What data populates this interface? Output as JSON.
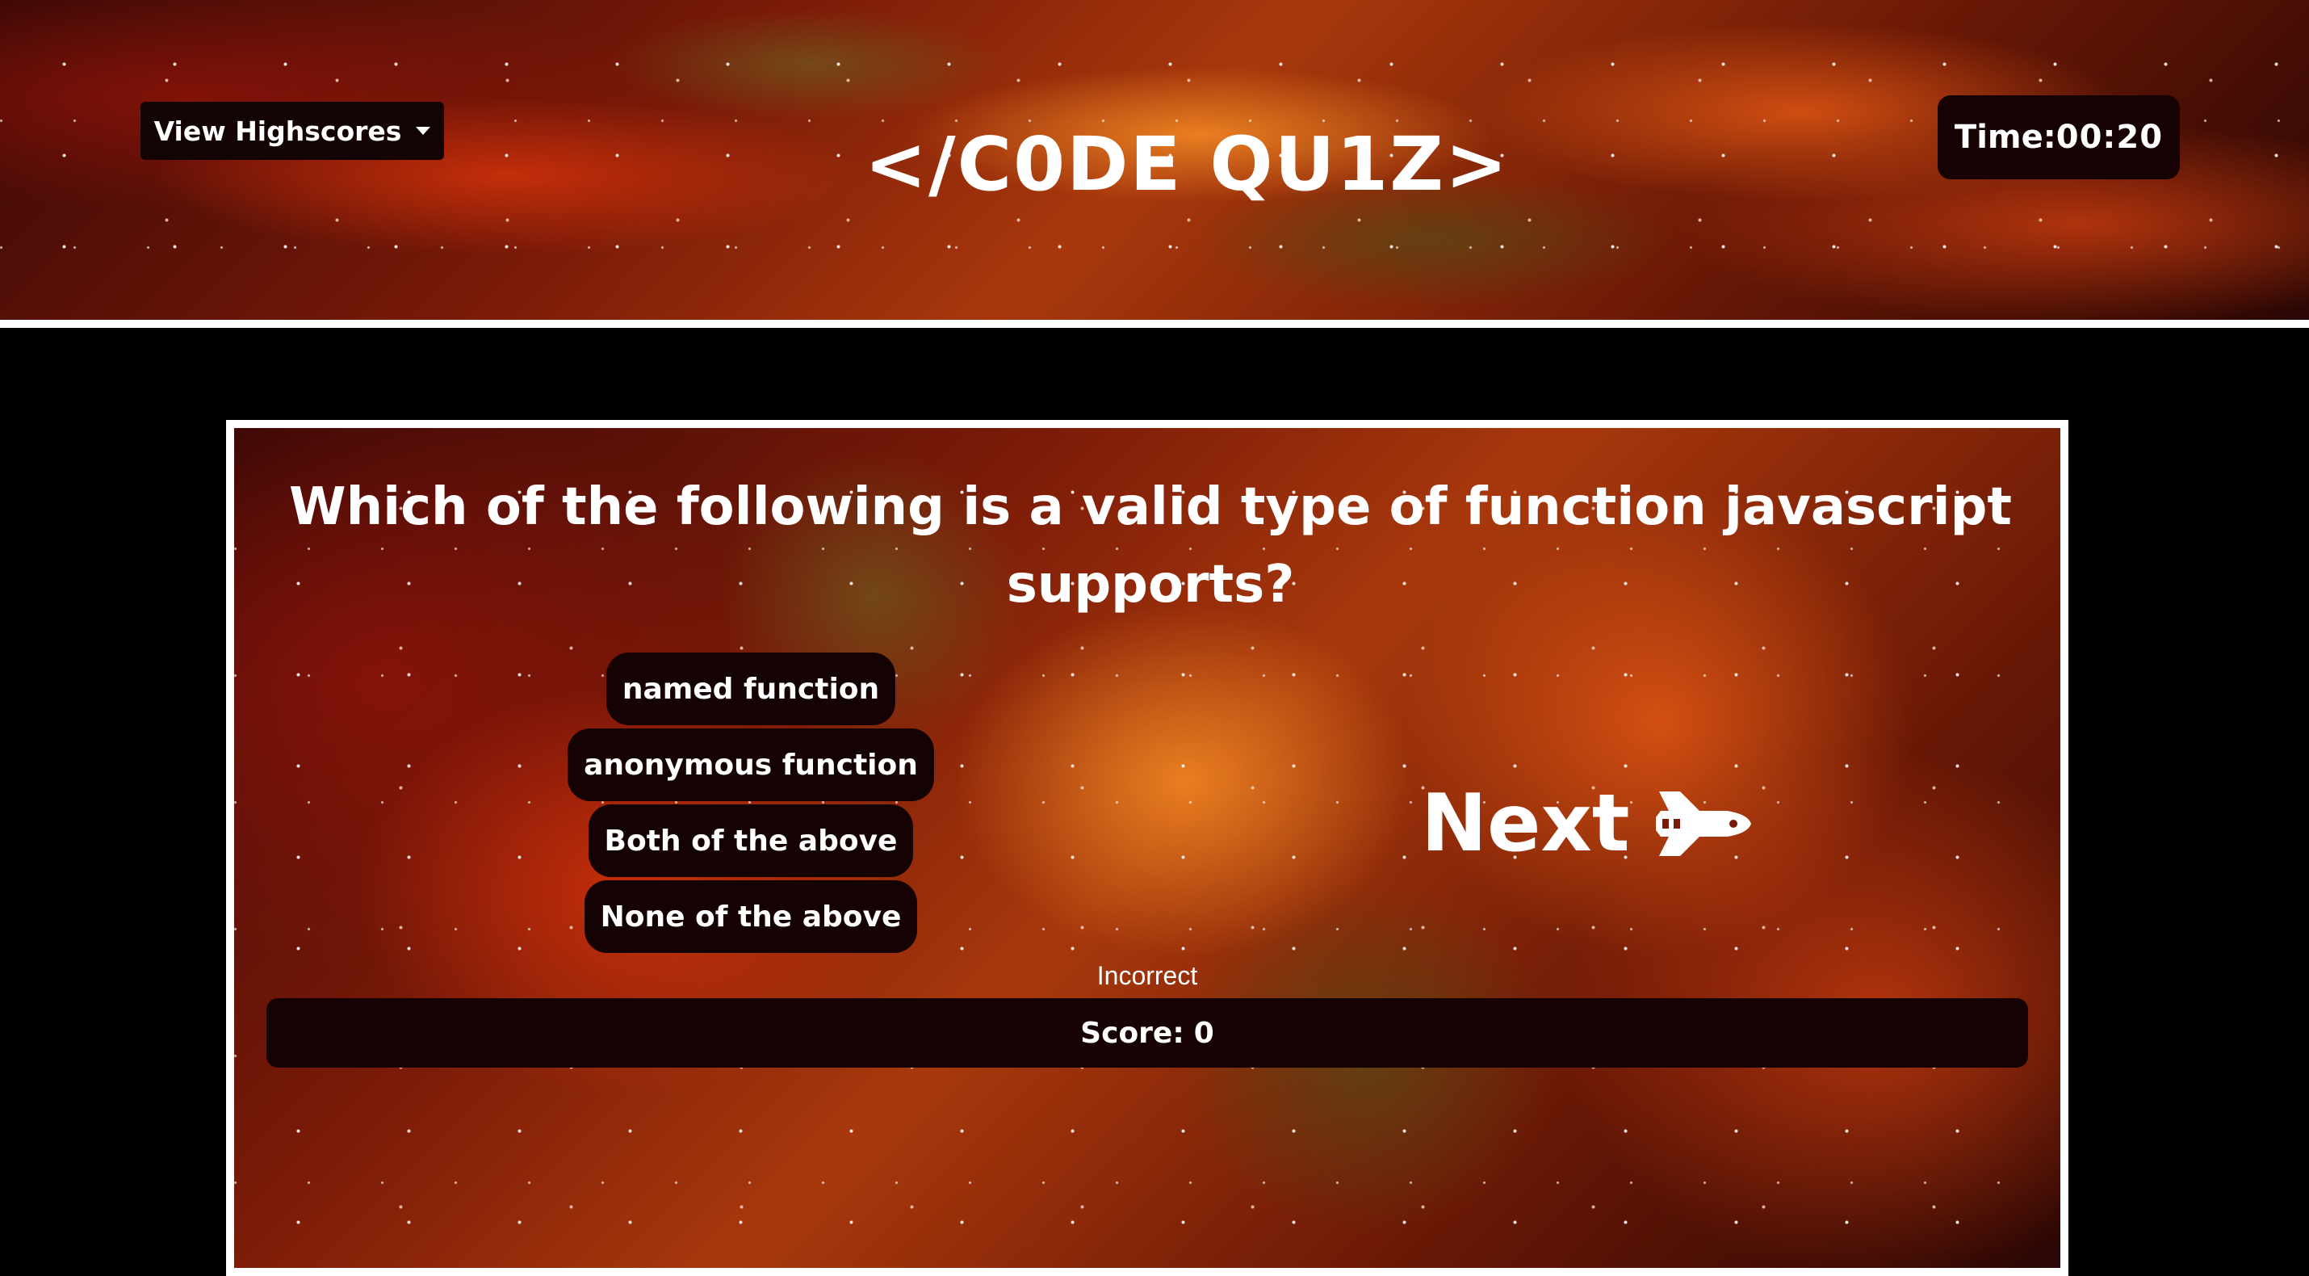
{
  "header": {
    "highscores_label": "View Highscores",
    "title": "</C0DE QU1Z>",
    "timer_label": "Time:",
    "timer_value": "00:20"
  },
  "quiz": {
    "question": "Which of the following is a valid type of function javascript supports?",
    "answers": [
      "named function",
      "anonymous function",
      "Both of the above",
      "None of the above"
    ],
    "next_label": "Next",
    "next_icon": "space-shuttle-icon",
    "feedback": "Incorrect",
    "score_label": "Score:",
    "score_value": "0"
  },
  "colors": {
    "panel": "#150202",
    "border": "#ffffff",
    "text": "#ffffff"
  }
}
